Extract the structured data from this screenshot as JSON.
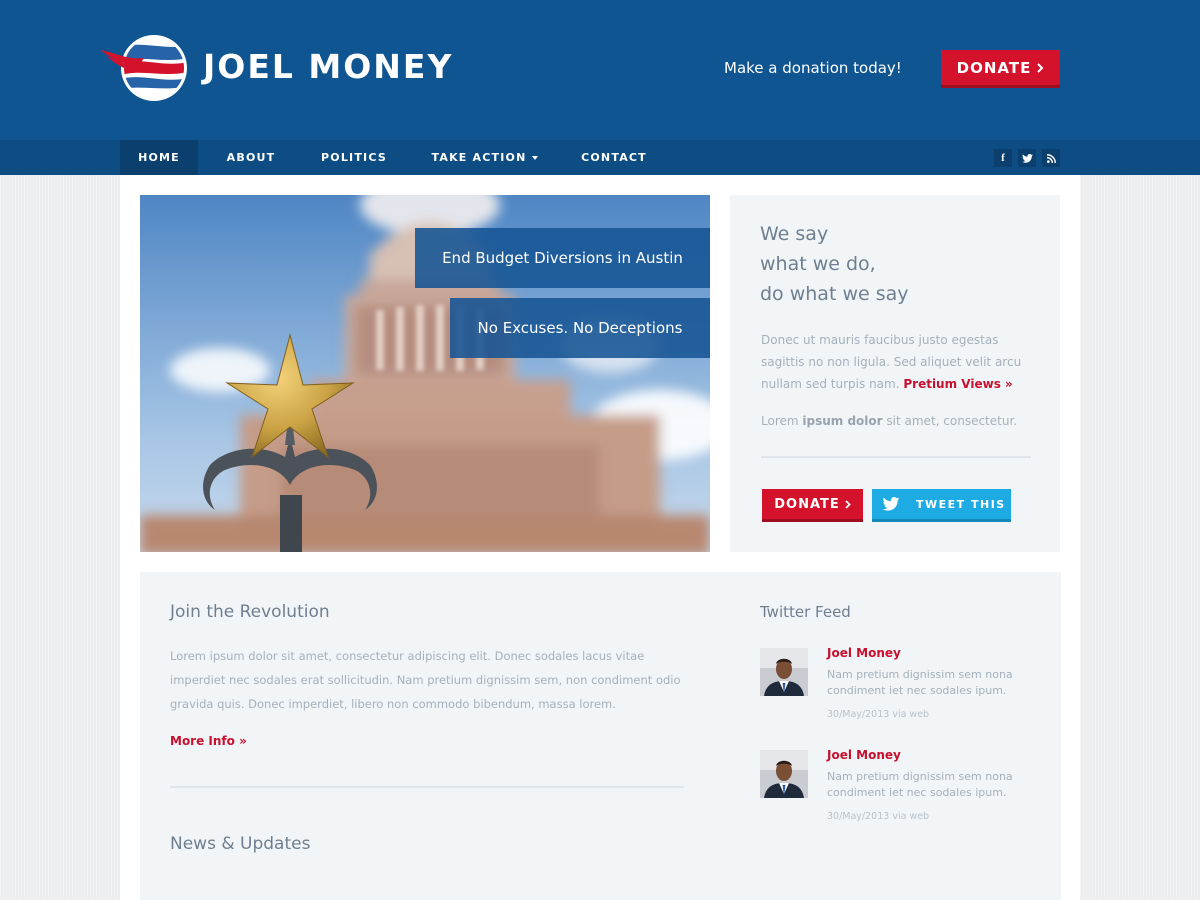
{
  "colors": {
    "header_blue": "#0f5592",
    "nav_blue": "#0e4d84",
    "accent_red": "#d4122c",
    "twitter_blue": "#1eaae3",
    "text_gray": "#a6b0ba",
    "heading_gray": "#6f7f8f"
  },
  "header": {
    "logo_text": "JOEL MONEY",
    "logo_icon": "flag-globe-logo",
    "tagline": "Make a donation today!",
    "donate_label": "DONATE"
  },
  "nav": {
    "items": [
      {
        "label": "HOME",
        "active": true
      },
      {
        "label": "ABOUT",
        "active": false
      },
      {
        "label": "POLITICS",
        "active": false
      },
      {
        "label": "TAKE ACTION",
        "active": false,
        "dropdown": true
      },
      {
        "label": "CONTACT",
        "active": false
      }
    ],
    "social": [
      {
        "icon": "facebook-icon",
        "glyph": "f"
      },
      {
        "icon": "twitter-icon",
        "glyph": "t"
      },
      {
        "icon": "rss-icon",
        "glyph": "rss"
      }
    ]
  },
  "hero": {
    "captions": [
      "End Budget Diversions in Austin",
      "No Excuses. No Deceptions"
    ]
  },
  "sidebar": {
    "headline_lines": [
      "We say",
      "what we do,",
      "do what we say"
    ],
    "paragraph": "Donec ut mauris faucibus justo egestas sagittis no non ligula. Sed aliquet velit arcu nullam sed turpis nam.",
    "paragraph_link": "Pretium Views »",
    "lorem_prefix": "Lorem",
    "lorem_bold": "ipsum dolor",
    "lorem_suffix": "sit amet, consectetur.",
    "donate_label": "DONATE",
    "tweet_label": "TWEET THIS"
  },
  "join": {
    "title": "Join the Revolution",
    "body": "Lorem ipsum dolor sit amet, consectetur adipiscing elit. Donec sodales lacus vitae imperdiet nec sodales erat sollicitudin. Nam pretium dignissim sem, non condiment odio gravida quis. Donec imperdiet, libero non commodo bibendum, massa lorem.",
    "link": "More Info »"
  },
  "news": {
    "title": "News & Updates"
  },
  "twitter_feed": {
    "title": "Twitter Feed",
    "tweets": [
      {
        "author": "Joel Money",
        "text": "Nam pretium dignissim sem nona condiment iet nec sodales ipum.",
        "meta": "30/May/2013 via web"
      },
      {
        "author": "Joel Money",
        "text": "Nam pretium dignissim sem nona condiment iet nec sodales ipum.",
        "meta": "30/May/2013 via web"
      }
    ]
  }
}
